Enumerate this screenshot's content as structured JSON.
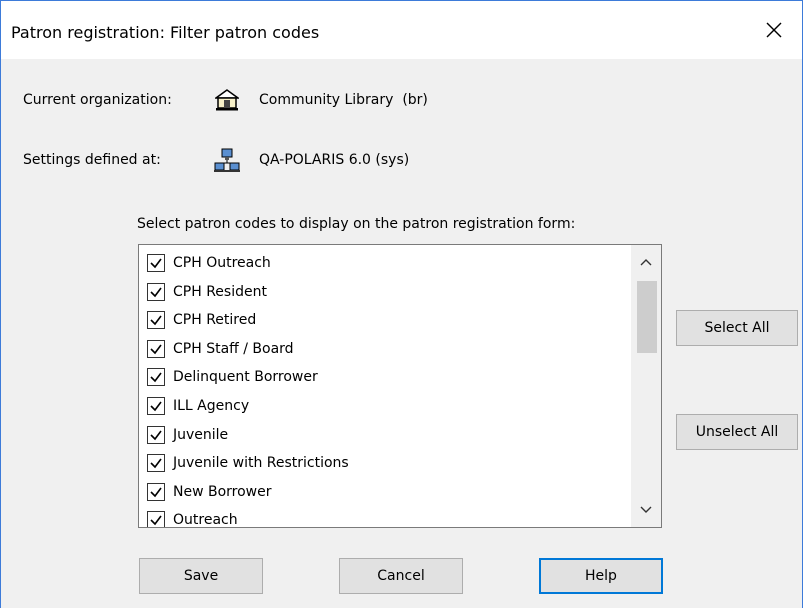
{
  "window": {
    "title": "Patron registration: Filter patron codes",
    "close_icon": "close-icon"
  },
  "info": {
    "org_label": "Current organization:",
    "org_value": "Community Library  (br)",
    "org_icon": "library-building-icon",
    "settings_label": "Settings defined at:",
    "settings_value": "QA-POLARIS 6.0 (sys)",
    "settings_icon": "network-computers-icon"
  },
  "prompt": "Select patron codes to display on the patron registration form:",
  "patron_codes": [
    {
      "label": "CPH Outreach",
      "checked": true
    },
    {
      "label": "CPH Resident",
      "checked": true
    },
    {
      "label": "CPH Retired",
      "checked": true
    },
    {
      "label": "CPH Staff / Board",
      "checked": true
    },
    {
      "label": "Delinquent Borrower",
      "checked": true
    },
    {
      "label": "ILL Agency",
      "checked": true
    },
    {
      "label": "Juvenile",
      "checked": true
    },
    {
      "label": "Juvenile with Restrictions",
      "checked": true
    },
    {
      "label": "New Borrower",
      "checked": true
    },
    {
      "label": "Outreach",
      "checked": true
    }
  ],
  "buttons": {
    "select_all": "Select All",
    "unselect_all": "Unselect All",
    "save": "Save",
    "cancel": "Cancel",
    "help": "Help"
  },
  "colors": {
    "window_border": "#3d7bd9",
    "default_button_border": "#0078d7",
    "dialog_bg": "#f0f0f0"
  }
}
